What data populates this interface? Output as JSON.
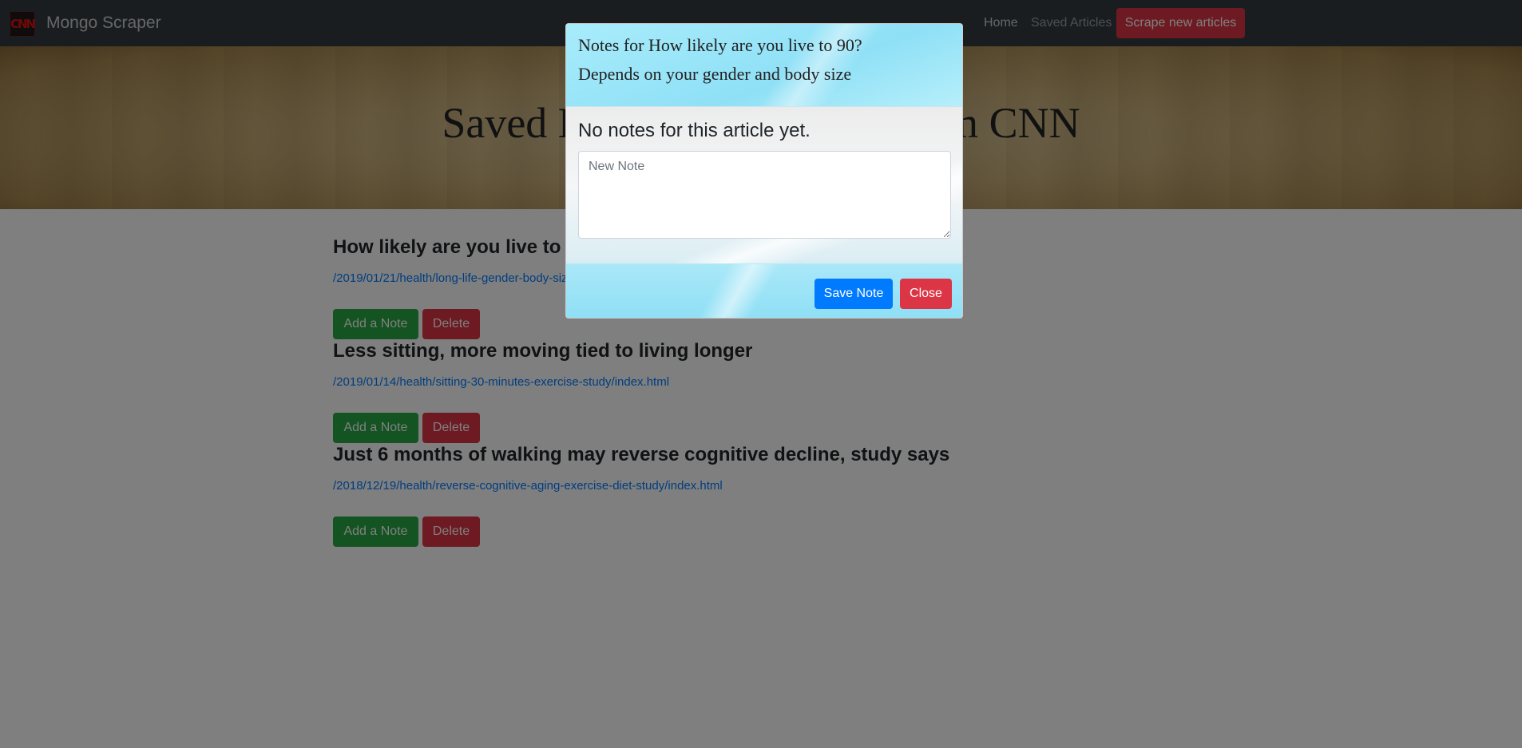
{
  "navbar": {
    "logo_text": "CNN",
    "brand": "Mongo Scraper",
    "home": "Home",
    "saved": "Saved Articles",
    "scrape": "Scrape new articles"
  },
  "jumbotron": {
    "title": "Saved Live Long Articles from CNN"
  },
  "articles": [
    {
      "title": "How likely are you live to 90? Depends on your gender and body size",
      "link": "/2019/01/21/health/long-life-gender-body-size-study/index.html",
      "add_note": "Add a Note",
      "delete": "Delete"
    },
    {
      "title": "Less sitting, more moving tied to living longer",
      "link": "/2019/01/14/health/sitting-30-minutes-exercise-study/index.html",
      "add_note": "Add a Note",
      "delete": "Delete"
    },
    {
      "title": "Just 6 months of walking may reverse cognitive decline, study says",
      "link": "/2018/12/19/health/reverse-cognitive-aging-exercise-diet-study/index.html",
      "add_note": "Add a Note",
      "delete": "Delete"
    }
  ],
  "modal": {
    "header_line1": "Notes for How likely are you live to 90?",
    "header_line2": "Depends on your gender and body size",
    "empty_message": "No notes for this article yet.",
    "note_placeholder": "New Note",
    "save": "Save Note",
    "close": "Close"
  },
  "colors": {
    "navbar_bg": "#343a40",
    "danger": "#dc3545",
    "success": "#28a745",
    "primary": "#007bff",
    "link": "#007bff"
  }
}
